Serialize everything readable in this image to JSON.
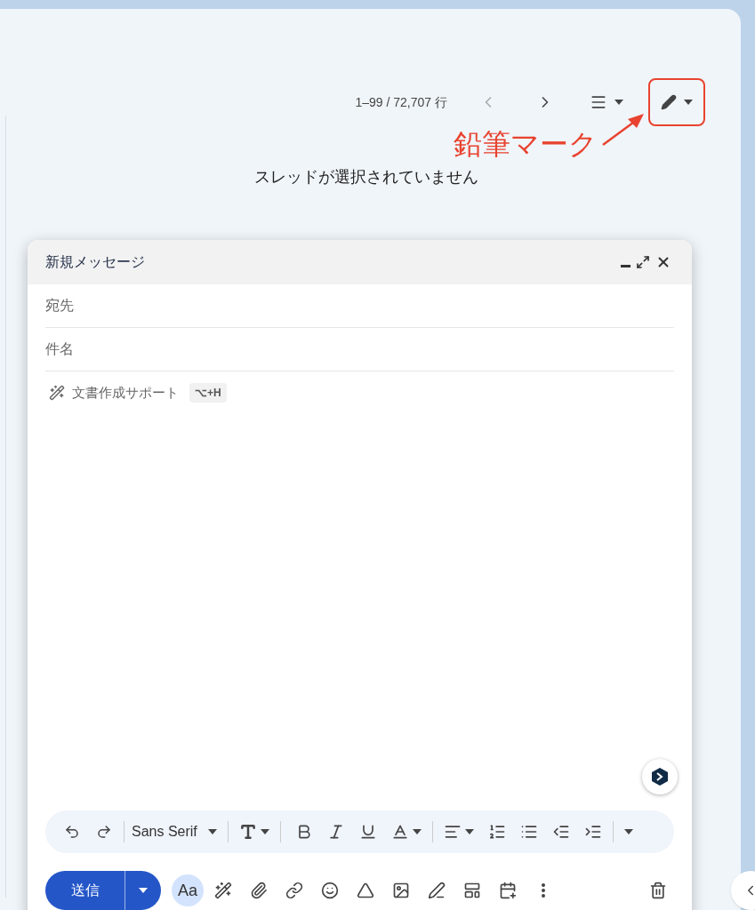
{
  "toolbar": {
    "pagination": "1–99 / 72,707 行"
  },
  "annotation": {
    "label": "鉛筆マーク"
  },
  "empty_message": "スレッドが選択されていません",
  "compose": {
    "title": "新規メッセージ",
    "fields": [
      {
        "placeholder": "宛先"
      },
      {
        "placeholder": "件名"
      }
    ],
    "writing_assist": {
      "label": "文書作成サポート",
      "shortcut": "⌥+H"
    },
    "formatting": {
      "font": "Sans Serif"
    },
    "send_label": "送信",
    "format_toggle": {
      "label": "Aa",
      "selected": true
    }
  }
}
